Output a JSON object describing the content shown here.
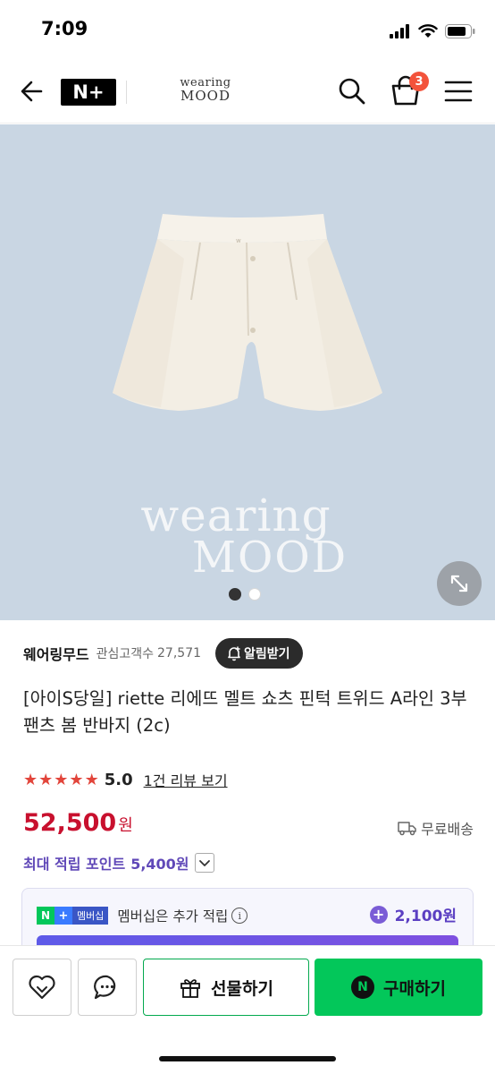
{
  "status_bar": {
    "time": "7:09"
  },
  "nav": {
    "logo_text": "N+",
    "brand_line1": "wearing",
    "brand_line2": "MOOD",
    "cart_count": "3"
  },
  "hero": {
    "watermark_line1": "wearing",
    "watermark_line2": "MOOD",
    "image_count": 2,
    "active_index": 0
  },
  "seller": {
    "name": "웨어링무드",
    "followers_label": "관심고객수",
    "followers": "27,571",
    "alarm_label": "알림받기"
  },
  "product": {
    "title": "[아이S당일] riette 리에뜨 멜트 쇼츠 핀턱 트위드 A라인 3부 팬츠 봄 반바지 (2c)",
    "rating": "5.0",
    "stars": 5,
    "review_link": "1건 리뷰 보기",
    "price": "52,500",
    "price_unit": "원",
    "shipping": "무료배송",
    "points_label": "최대 적립 포인트",
    "points_value": "5,400원"
  },
  "membership": {
    "badge_label": "멤버십",
    "text": "멤버십은 추가 적립",
    "amount": "2,100원"
  },
  "actions": {
    "gift_label": "선물하기",
    "buy_label": "구매하기"
  },
  "colors": {
    "price": "#c8102e",
    "points": "#6048b8",
    "naver_green": "#03c75a",
    "hero_bg": "#c9d6e3"
  }
}
